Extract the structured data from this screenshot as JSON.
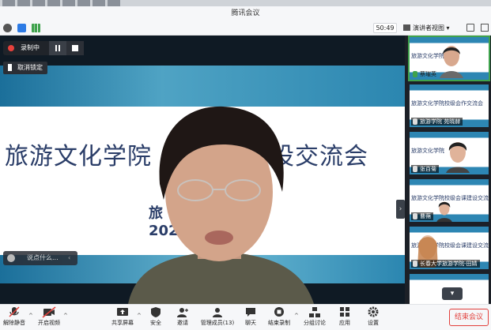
{
  "window": {
    "title": "腾讯会议"
  },
  "toolbar": {
    "timer": "50:49",
    "view_mode": "演讲者视图"
  },
  "recording": {
    "status": "录制中",
    "unpin_label": "取消锁定"
  },
  "slide": {
    "title_left": "旅游文化学院",
    "title_right": "设交流会",
    "subtitle_left": "旅",
    "subtitle_year": "202"
  },
  "chat": {
    "placeholder": "说点什么..."
  },
  "participants": [
    {
      "name": "蔡璀英",
      "slide_text": "旅游文化学院校",
      "active": true
    },
    {
      "name": "旅游学院 苑晓赫",
      "slide_text": "旅游文化学院校级会作交流会",
      "active": false
    },
    {
      "name": "张百菊",
      "slide_text": "旅游文化学院",
      "active": false
    },
    {
      "name": "曹蒴",
      "slide_text": "旅游文化学院校级会课建设交流会",
      "active": false
    },
    {
      "name": "长春大学旅游学院-田婧",
      "slide_text": "旅游文化学院校级会课建设交流会",
      "active": false
    }
  ],
  "bottom": {
    "mute": "解除静音",
    "video": "开启视频",
    "share": "共享屏幕",
    "security": "安全",
    "invite": "邀请",
    "members": "管理成员(13)",
    "chat": "聊天",
    "record": "结束录制",
    "breakout": "分组讨论",
    "apps": "应用",
    "settings": "设置",
    "end": "结束会议"
  },
  "colors": {
    "accent_red": "#e2403c",
    "active_green": "#3fa24c",
    "slide_blue": "#2b86b0"
  }
}
